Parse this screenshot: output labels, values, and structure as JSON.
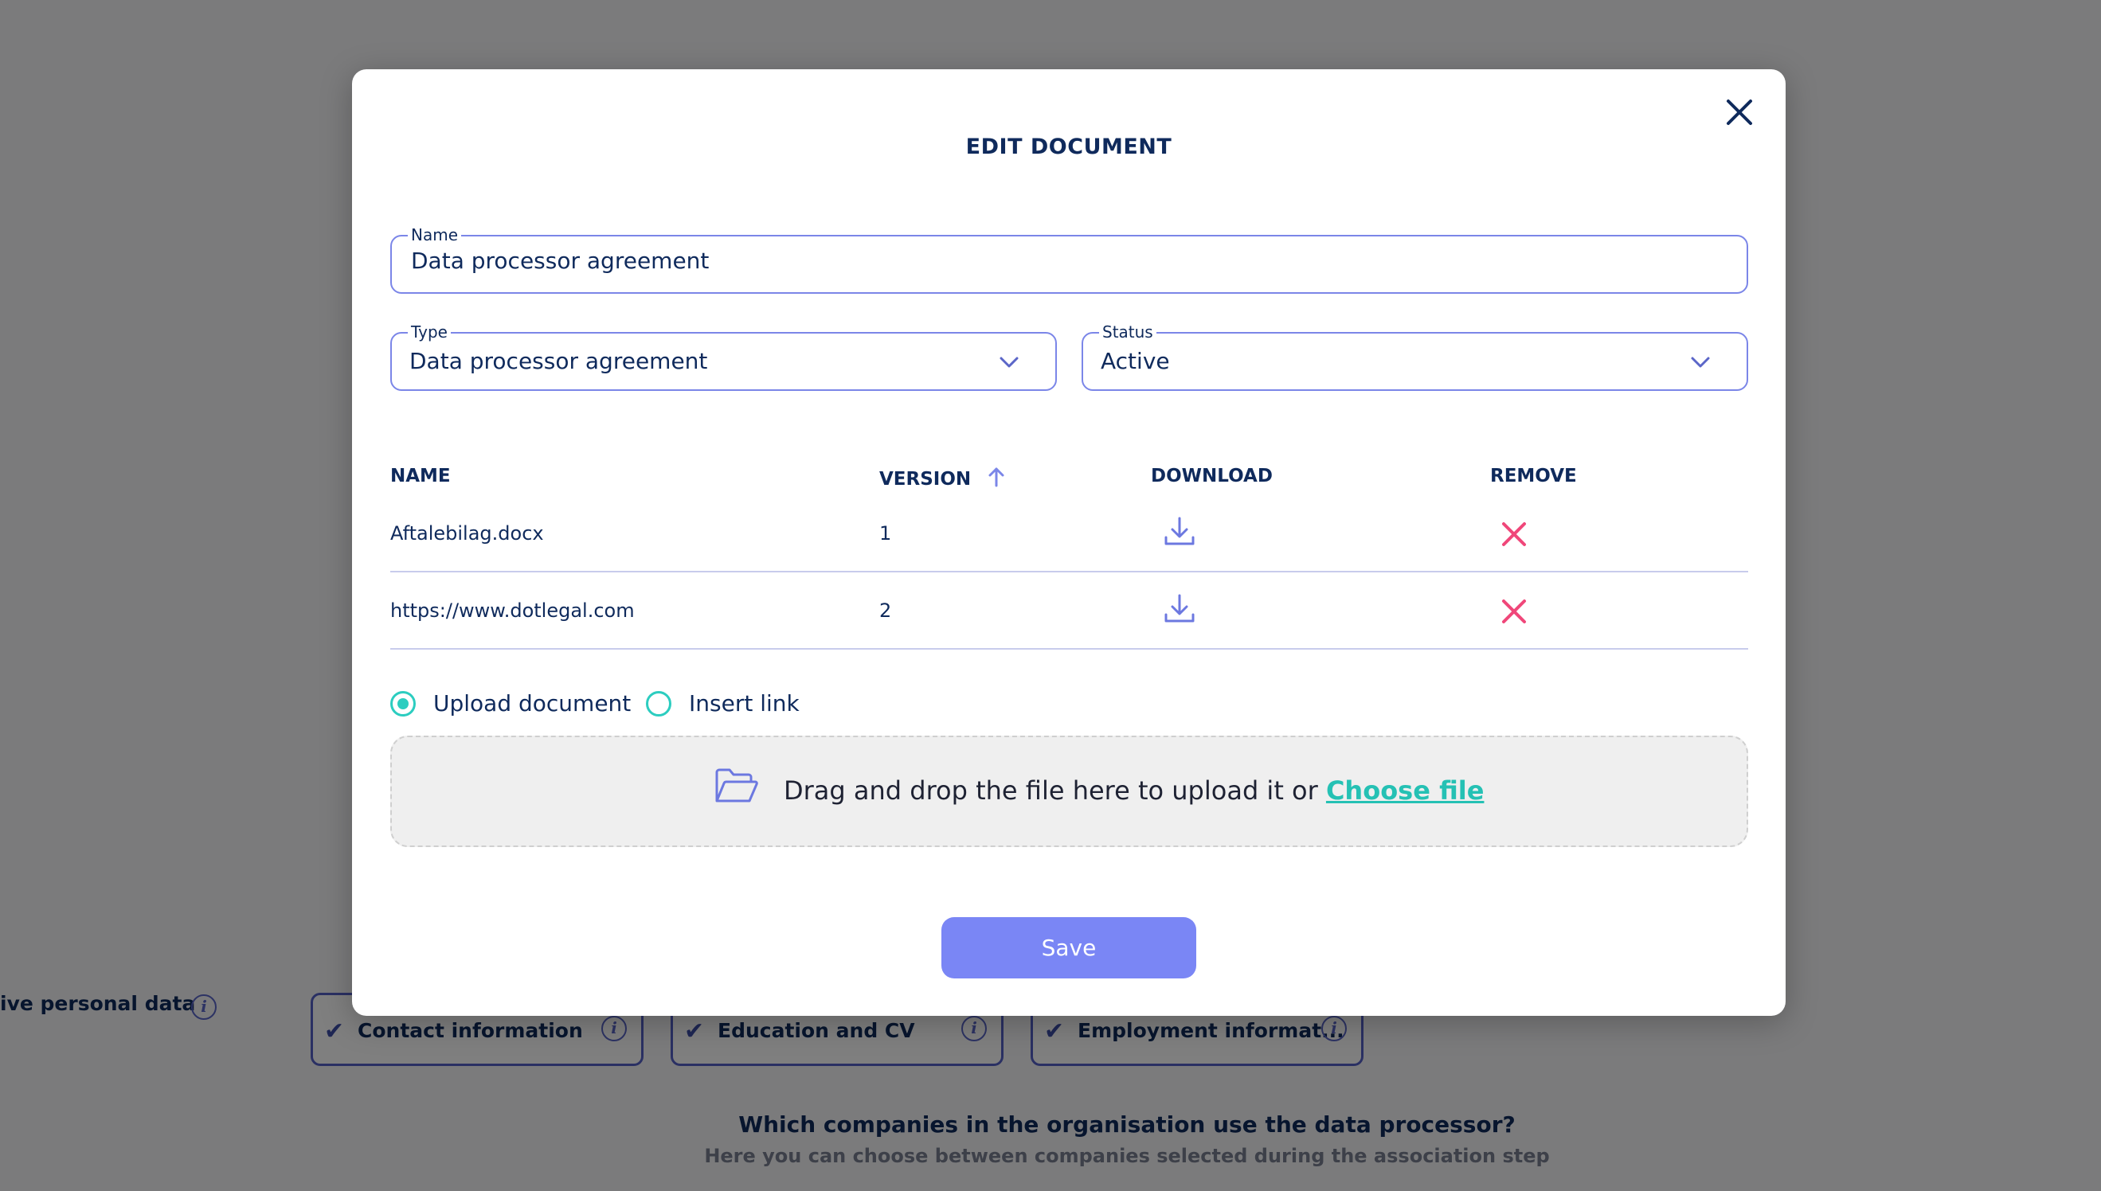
{
  "background": {
    "section_label": "ive personal data",
    "chips": [
      {
        "label": "Contact information"
      },
      {
        "label": "Education and CV"
      },
      {
        "label": "Employment informat..."
      }
    ],
    "question": "Which companies in the organisation use the data processor?",
    "question_sub": "Here you can choose between companies selected during the association step"
  },
  "modal": {
    "title": "EDIT DOCUMENT",
    "name_field": {
      "label": "Name",
      "value": "Data processor agreement"
    },
    "type_field": {
      "label": "Type",
      "value": "Data processor agreement"
    },
    "status_field": {
      "label": "Status",
      "value": "Active"
    },
    "table": {
      "headers": {
        "name": "NAME",
        "version": "VERSION",
        "download": "DOWNLOAD",
        "remove": "REMOVE"
      },
      "rows": [
        {
          "name": "Aftalebilag.docx",
          "version": "1"
        },
        {
          "name": "https://www.dotlegal.com",
          "version": "2"
        }
      ]
    },
    "upload_options": [
      {
        "label": "Upload document",
        "selected": true
      },
      {
        "label": "Insert link",
        "selected": false
      }
    ],
    "dropzone": {
      "text": "Drag and drop the file here to upload it or",
      "link": "Choose file"
    },
    "save_label": "Save"
  },
  "colors": {
    "primary": "#7a86f5",
    "teal": "#2ccdc0",
    "danger": "#f0477a",
    "text": "#0f2a5c"
  },
  "icons": [
    "close-icon",
    "chevron-down-icon",
    "arrow-up-icon",
    "download-icon",
    "remove-icon",
    "folder-open-icon",
    "info-icon",
    "check-icon"
  ]
}
